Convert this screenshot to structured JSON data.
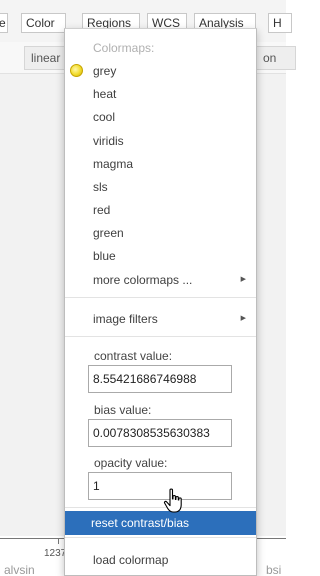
{
  "menubar": {
    "cut_left": "e",
    "items": [
      "Color",
      "Regions",
      "WCS",
      "Analysis"
    ],
    "cut_right": "H"
  },
  "toolbar": {
    "scale_label": "linear",
    "cut_right": "on"
  },
  "axis": {
    "tick_label": "1237"
  },
  "bottom": {
    "left_text": "alvsin",
    "right_text": "bsi"
  },
  "colormap_menu": {
    "header": "Colormaps:",
    "selected": "grey",
    "items": [
      "grey",
      "heat",
      "cool",
      "viridis",
      "magma",
      "sls",
      "red",
      "green",
      "blue"
    ],
    "more": "more colormaps ...",
    "image_filters": "image filters",
    "contrast_label": "contrast value:",
    "contrast_value": "8.55421686746988",
    "bias_label": "bias value:",
    "bias_value": "0.0078308535630383",
    "opacity_label": "opacity value:",
    "opacity_value": "1",
    "reset": "reset contrast/bias",
    "load": "load colormap"
  },
  "colors": {
    "highlight": "#2c6fbb",
    "selected_dot": "#f2dc2c"
  },
  "icons": {
    "submenu": "submenu-arrow-icon",
    "selection": "selected-radio-icon",
    "cursor": "hand-pointer-icon"
  }
}
